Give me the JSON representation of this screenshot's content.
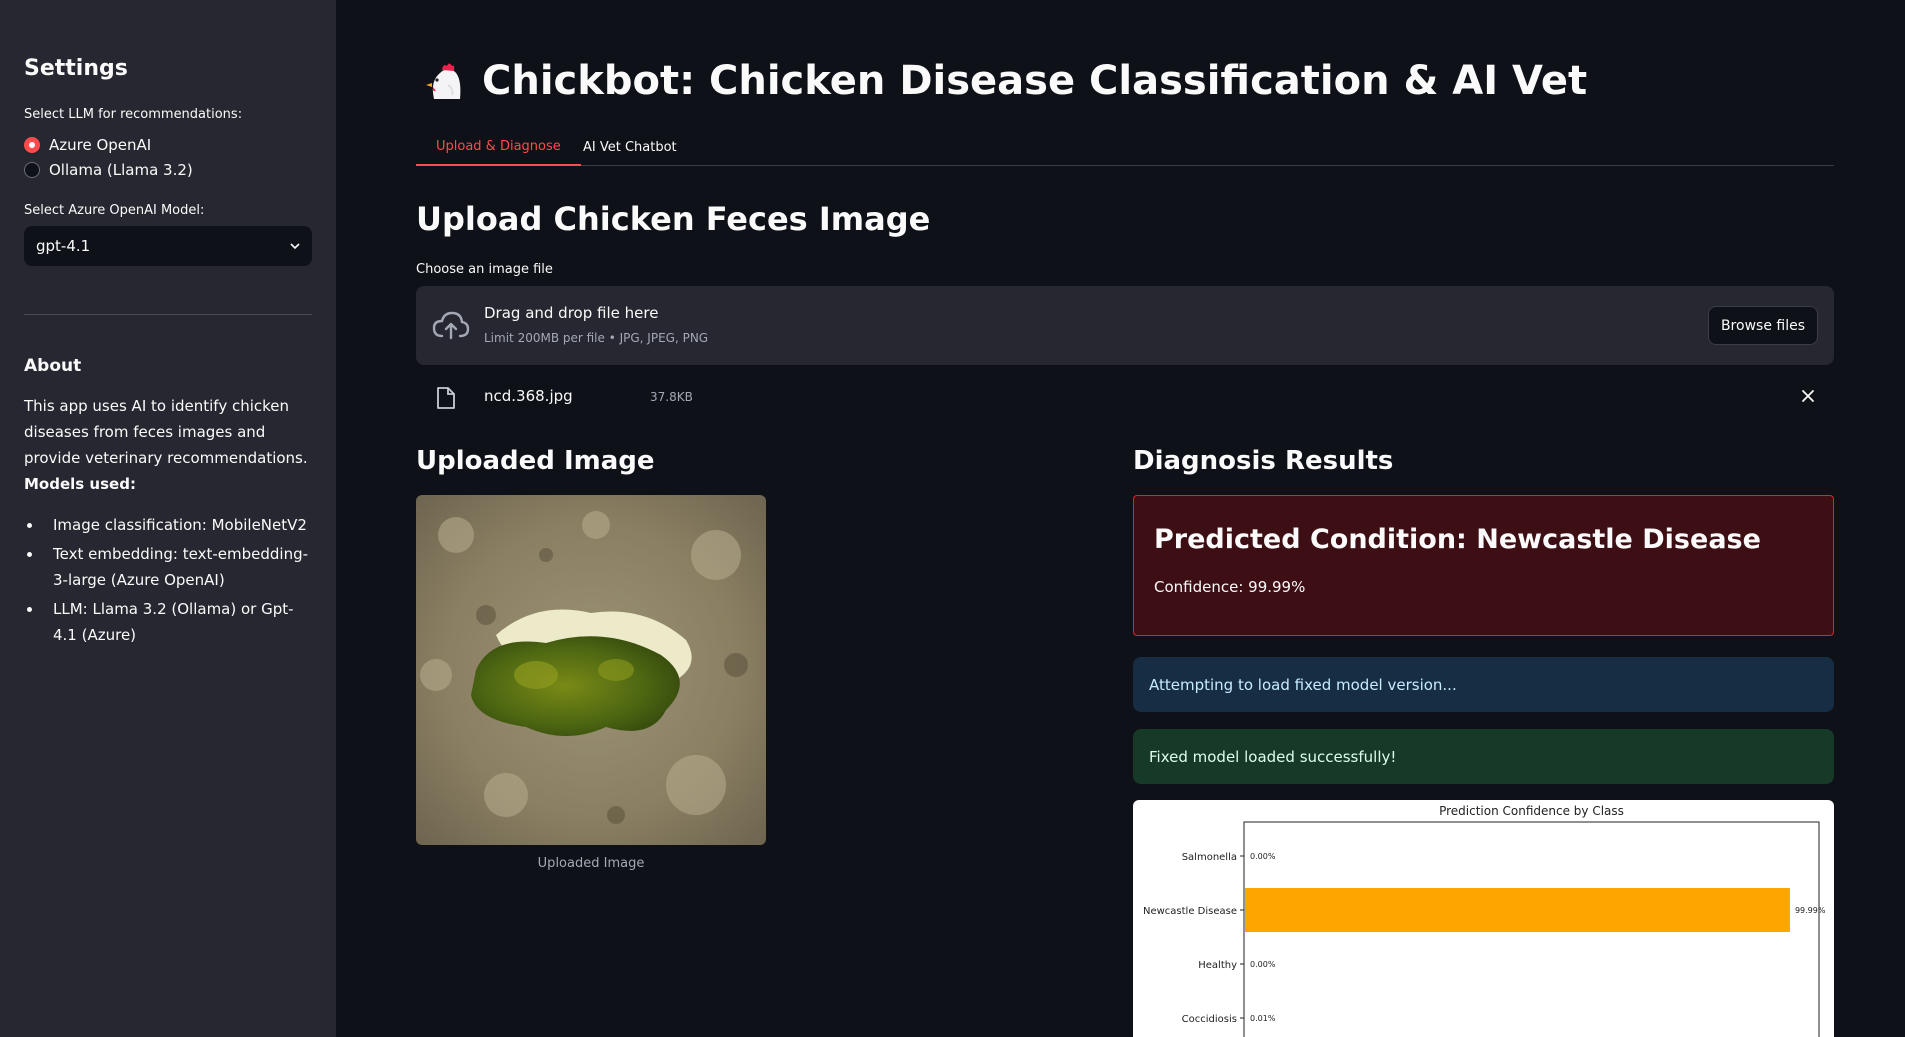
{
  "sidebar": {
    "title": "Settings",
    "llm_label": "Select LLM for recommendations:",
    "llm_options": [
      {
        "label": "Azure OpenAI",
        "selected": true
      },
      {
        "label": "Ollama (Llama 3.2)",
        "selected": false
      }
    ],
    "model_label": "Select Azure OpenAI Model:",
    "model_value": "gpt-4.1",
    "about_title": "About",
    "about_text": "This app uses AI to identify chicken diseases from feces images and provide veterinary recommendations.",
    "about_models_label": "Models used:",
    "models_list": [
      "Image classification: MobileNetV2",
      "Text embedding: text-embedding-3-large (Azure OpenAI)",
      "LLM: Llama 3.2 (Ollama) or Gpt-4.1 (Azure)"
    ]
  },
  "header": {
    "title": "Chickbot: Chicken Disease Classification & AI Vet",
    "icon": "chicken-emoji-icon"
  },
  "tabs": [
    {
      "label": "Upload & Diagnose",
      "active": true
    },
    {
      "label": "AI Vet Chatbot",
      "active": false
    }
  ],
  "upload": {
    "heading": "Upload Chicken Feces Image",
    "field_label": "Choose an image file",
    "drop_text": "Drag and drop file here",
    "limit_text": "Limit 200MB per file • JPG, JPEG, PNG",
    "browse_label": "Browse files",
    "file_name": "ncd.368.jpg",
    "file_size": "37.8KB"
  },
  "image_section": {
    "heading": "Uploaded Image",
    "caption": "Uploaded Image"
  },
  "diagnosis": {
    "heading": "Diagnosis Results",
    "predicted": "Predicted Condition: Newcastle Disease",
    "confidence": "Confidence: 99.99%",
    "info_msg": "Attempting to load fixed model version...",
    "success_msg": "Fixed model loaded successfully!"
  },
  "colors": {
    "accent": "#ff4b4b",
    "bar": "#ffa500"
  },
  "chart_data": {
    "type": "bar",
    "orientation": "horizontal",
    "title": "Prediction Confidence by Class",
    "categories": [
      "Salmonella",
      "Newcastle Disease",
      "Healthy",
      "Coccidiosis"
    ],
    "values": [
      0.0,
      99.99,
      0.0,
      0.01
    ],
    "value_labels": [
      "0.00%",
      "99.99%",
      "0.00%",
      "0.01%"
    ],
    "xlim": [
      0,
      100
    ]
  }
}
